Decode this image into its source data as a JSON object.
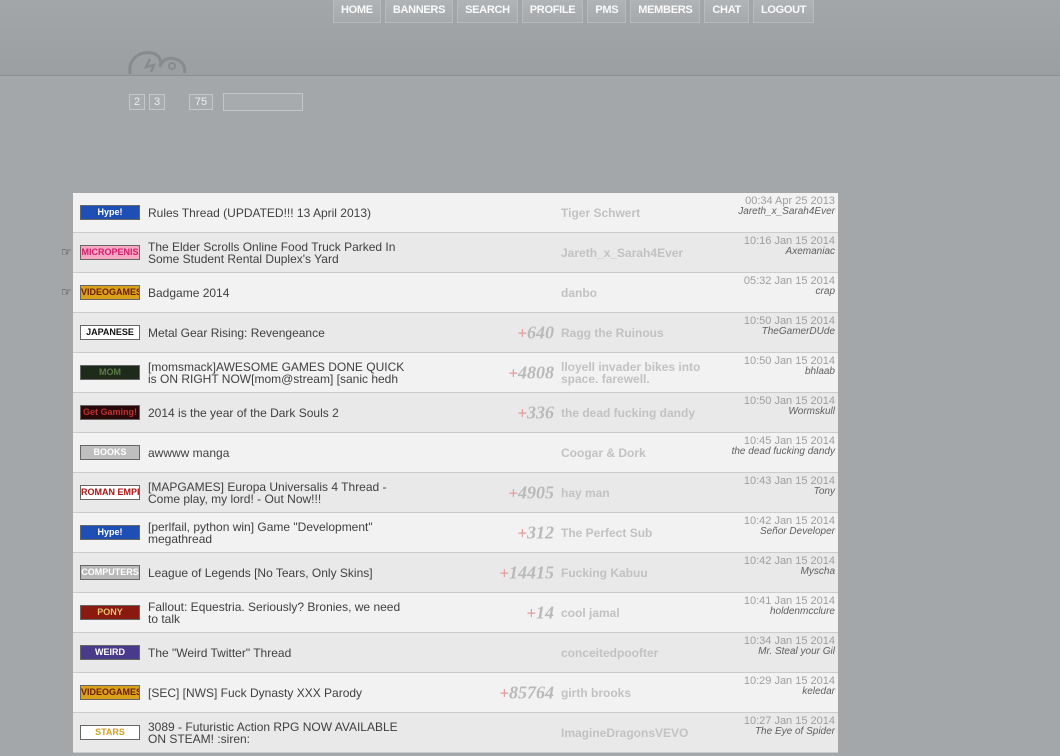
{
  "nav": [
    "HOME",
    "BANNERS",
    "SEARCH",
    "PROFILE",
    "PMS",
    "MEMBERS",
    "CHAT",
    "LOGOUT"
  ],
  "pager": {
    "p2": "2",
    "p3": "3",
    "last": "75"
  },
  "threads": [
    {
      "tag": "Hype!",
      "tag_bg": "#1d4fb5",
      "tag_fg": "#ffffff",
      "title": "Rules Thread (UPDATED!!! 13 April 2013)",
      "replies": "",
      "author": "Tiger Schwert",
      "time": "00:34 Apr 25 2013",
      "last": "Jareth_x_Sarah4Ever",
      "bm": false
    },
    {
      "tag": "MICROPENIS",
      "tag_bg": "#f7a6c4",
      "tag_fg": "#d21e6a",
      "title": "The Elder Scrolls Online Food Truck Parked In Some Student Rental Duplex's Yard",
      "replies": "",
      "author": "Jareth_x_Sarah4Ever",
      "time": "10:16 Jan 15 2014",
      "last": "Axemaniac",
      "bm": true
    },
    {
      "tag": "VIDEOGAMES",
      "tag_bg": "#d9a21a",
      "tag_fg": "#6a1a00",
      "title": "Badgame 2014",
      "replies": "",
      "author": "danbo",
      "time": "05:32 Jan 15 2014",
      "last": "crap",
      "bm": true
    },
    {
      "tag": "JAPANESE",
      "tag_bg": "#ffffff",
      "tag_fg": "#111111",
      "title": "Metal Gear Rising: Revengeance",
      "replies": "640",
      "author": "Ragg the Ruinous",
      "time": "10:50 Jan 15 2014",
      "last": "TheGamerDUde",
      "bm": false
    },
    {
      "tag": "MOM",
      "tag_bg": "#1e2a1a",
      "tag_fg": "#5c7a4a",
      "title": "[momsmack]AWESOME GAMES DONE QUICK is ON RIGHT NOW[mom@stream] [sanic hedh",
      "replies": "4808",
      "author": "lloyell invader bikes into space. farewell.",
      "time": "10:50 Jan 15 2014",
      "last": "bhlaab",
      "bm": false
    },
    {
      "tag": "Get Gaming!",
      "tag_bg": "#2a0808",
      "tag_fg": "#c03030",
      "title": "2014 is the year of the Dark Souls 2",
      "replies": "336",
      "author": "the dead fucking dandy",
      "time": "10:50 Jan 15 2014",
      "last": "Wormskull",
      "bm": false
    },
    {
      "tag": "BOOKS",
      "tag_bg": "#bfbfbf",
      "tag_fg": "#ffffff",
      "title": "awwww manga",
      "replies": "",
      "author": "Coogar & Dork",
      "time": "10:45 Jan 15 2014",
      "last": "the dead fucking dandy",
      "bm": false
    },
    {
      "tag": "ROMAN EMPIRE",
      "tag_bg": "#ffffff",
      "tag_fg": "#b01010",
      "title": "[MAPGAMES] Europa Universalis 4 Thread - Come play, my lord! - Out Now!!!",
      "replies": "4905",
      "author": "hay man",
      "time": "10:43 Jan 15 2014",
      "last": "Tony",
      "bm": false
    },
    {
      "tag": "Hype!",
      "tag_bg": "#1d4fb5",
      "tag_fg": "#ffffff",
      "title": "[perlfail, python win] Game \"Development\" megathread",
      "replies": "312",
      "author": "The Perfect Sub",
      "time": "10:42 Jan 15 2014",
      "last": "Señor Developer",
      "bm": false
    },
    {
      "tag": "COMPUTERS",
      "tag_bg": "#b9b9b9",
      "tag_fg": "#ffffff",
      "title": "League of Legends [No Tears, Only Skins]",
      "replies": "14415",
      "author": "Fucking Kabuu",
      "time": "10:42 Jan 15 2014",
      "last": "Myscha",
      "bm": false
    },
    {
      "tag": "PONY",
      "tag_bg": "#8a1a10",
      "tag_fg": "#e8c070",
      "title": "Fallout: Equestria. Seriously? Bronies, we need to talk",
      "replies": "14",
      "author": "cool jamal",
      "time": "10:41 Jan 15 2014",
      "last": "holdenmcclure",
      "bm": false
    },
    {
      "tag": "WEIRD",
      "tag_bg": "#4a3a8a",
      "tag_fg": "#ffffff",
      "title": "The \"Weird Twitter\" Thread",
      "replies": "",
      "author": "conceitedpoofter",
      "time": "10:34 Jan 15 2014",
      "last": "Mr. Steal your Gil",
      "bm": false
    },
    {
      "tag": "VIDEOGAMES",
      "tag_bg": "#d9a21a",
      "tag_fg": "#6a1a00",
      "title": "[SEC] [NWS] Fuck Dynasty XXX Parody",
      "replies": "85764",
      "author": "girth brooks",
      "time": "10:29 Jan 15 2014",
      "last": "keledar",
      "bm": false
    },
    {
      "tag": "STARS",
      "tag_bg": "#ffffff",
      "tag_fg": "#d4a020",
      "title": "3089 - Futuristic Action RPG NOW AVAILABLE ON STEAM! :siren:",
      "replies": "",
      "author": "ImagineDragonsVEVO",
      "time": "10:27 Jan 15 2014",
      "last": "The Eye of Spider",
      "bm": false
    }
  ]
}
